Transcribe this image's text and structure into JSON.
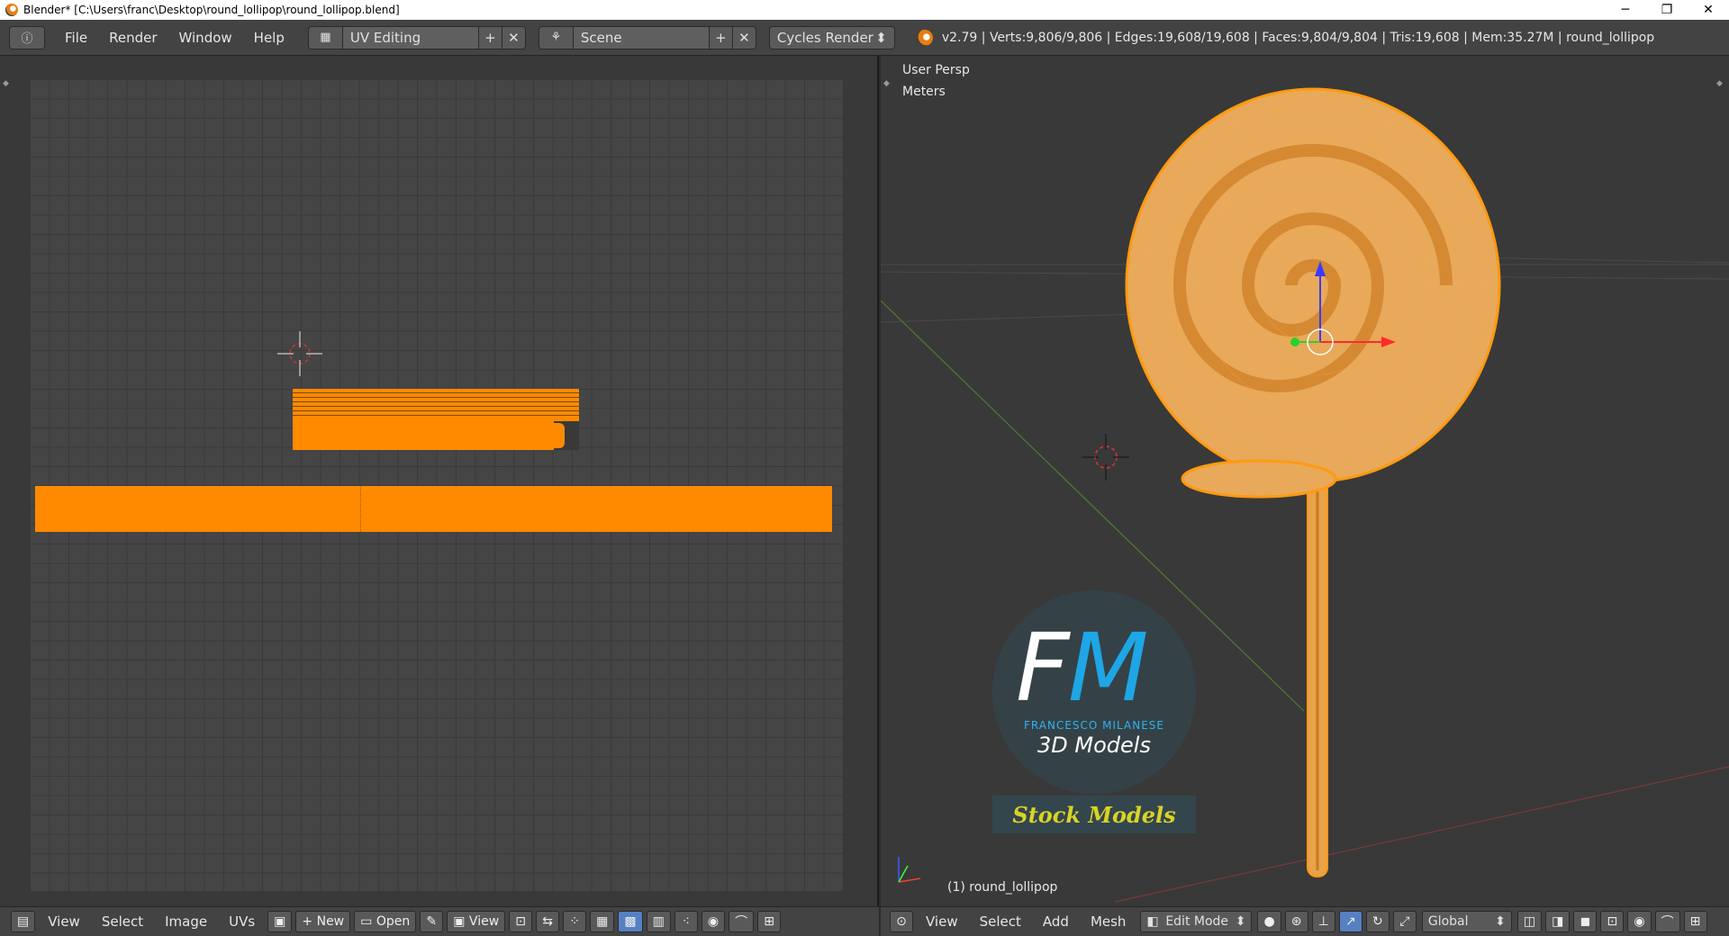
{
  "window": {
    "title": "Blender* [C:\\Users\\franc\\Desktop\\round_lollipop\\round_lollipop.blend]",
    "minimize": "─",
    "restore": "❐",
    "close": "✕"
  },
  "header": {
    "editor_icon": "ⓘ",
    "menus": [
      "File",
      "Render",
      "Window",
      "Help"
    ],
    "layout": {
      "icon": "▦",
      "label": "UV Editing",
      "add": "+",
      "remove": "✕"
    },
    "scene": {
      "icon": "⚘",
      "label": "Scene",
      "add": "+",
      "remove": "✕"
    },
    "render_engine": "Cycles Render",
    "stats": "v2.79 | Verts:9,806/9,806 | Edges:19,608/19,608 | Faces:9,804/9,804 | Tris:19,608 | Mem:35.27M | round_lollipop"
  },
  "viewport": {
    "view_name": "User Persp",
    "units": "Meters",
    "object_label": "(1) round_lollipop"
  },
  "logo": {
    "letter_f": "F",
    "letter_m": "M",
    "name": "FRANCESCO MILANESE",
    "subtitle": "3D Models",
    "badge": "Stock Models"
  },
  "uv_footer": {
    "menus": [
      "View",
      "Select",
      "Image",
      "UVs"
    ],
    "new_label": "New",
    "open_label": "Open",
    "view_label": "View"
  },
  "vp_footer": {
    "menus": [
      "View",
      "Select",
      "Add",
      "Mesh"
    ],
    "mode": "Edit Mode",
    "orientation": "Global"
  },
  "colors": {
    "selection": "#ff8a00",
    "logo_blue": "#1ea6e6",
    "badge_yellow": "#d9d326"
  }
}
